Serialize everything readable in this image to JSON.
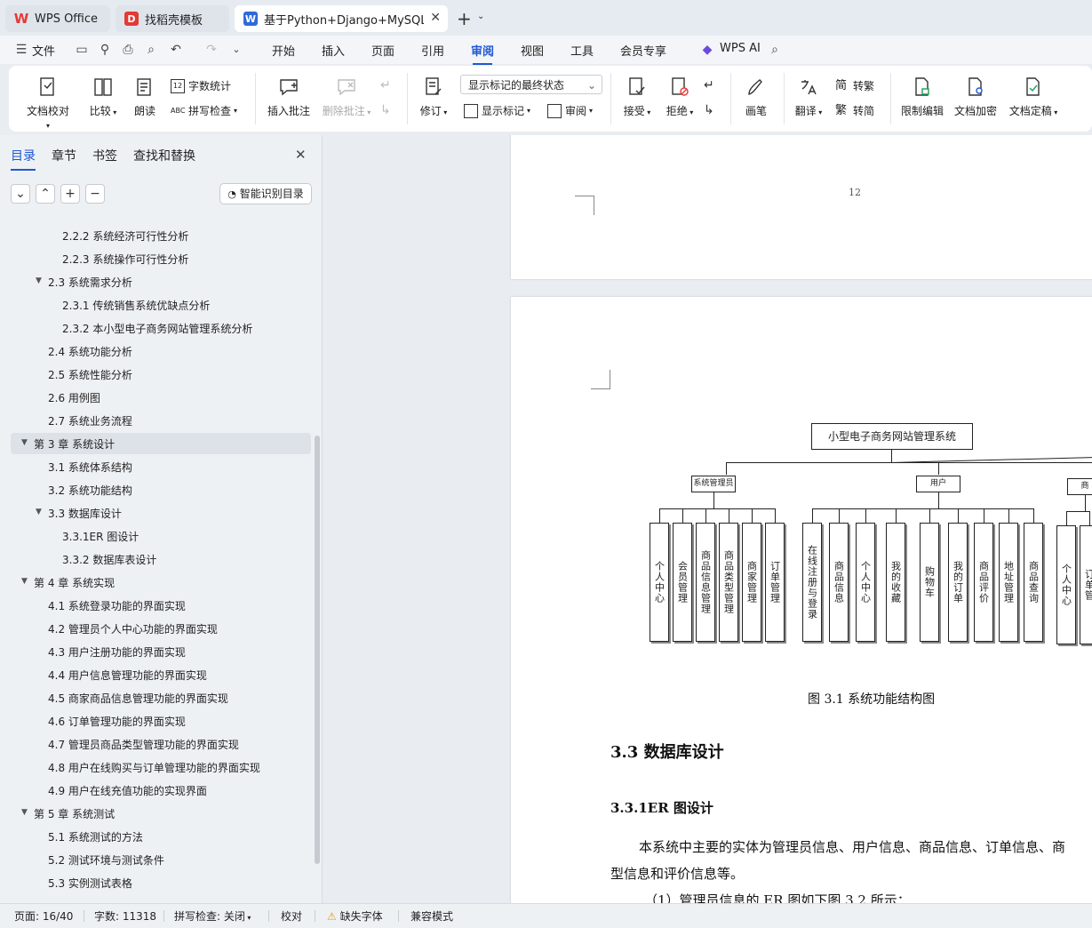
{
  "tabs": [
    {
      "label": "WPS Office",
      "icon": "wps-logo-icon"
    },
    {
      "label": "找稻壳模板",
      "icon": "docer-icon"
    },
    {
      "label": "基于Python+Django+MySQL",
      "icon": "word-doc-icon"
    }
  ],
  "menu": {
    "file_label": "文件",
    "items": [
      "开始",
      "插入",
      "页面",
      "引用",
      "审阅",
      "视图",
      "工具",
      "会员专享"
    ],
    "active": "审阅",
    "wps_ai_label": "WPS AI"
  },
  "ribbon": {
    "doc_proofread": "文档校对",
    "compare": "比较",
    "read_aloud": "朗读",
    "word_count": "字数统计",
    "spell_check": "拼写检查",
    "insert_comment": "插入批注",
    "delete_comment": "删除批注",
    "revise": "修订",
    "markup_state": "显示标记的最终状态",
    "show_markup": "显示标记",
    "review": "审阅",
    "accept": "接受",
    "reject": "拒绝",
    "pen": "画笔",
    "translate": "翻译",
    "to_traditional": "转繁",
    "to_simplified": "转简",
    "trad_glyph": "繁",
    "simp_glyph": "简",
    "restrict_edit": "限制编辑",
    "encrypt": "文档加密",
    "finalize": "文档定稿"
  },
  "nav": {
    "tabs": [
      "目录",
      "章节",
      "书签",
      "查找和替换"
    ],
    "smart_toc_label": "智能识别目录",
    "items": [
      {
        "text": "2.2.2 系统经济可行性分析",
        "level": 3
      },
      {
        "text": "2.2.3 系统操作可行性分析",
        "level": 3
      },
      {
        "text": "2.3 系统需求分析",
        "level": 2,
        "expanded": true
      },
      {
        "text": "2.3.1 传统销售系统优缺点分析",
        "level": 3
      },
      {
        "text": "2.3.2 本小型电子商务网站管理系统分析",
        "level": 3
      },
      {
        "text": "2.4 系统功能分析",
        "level": 2
      },
      {
        "text": "2.5 系统性能分析",
        "level": 2
      },
      {
        "text": "2.6 用例图",
        "level": 2
      },
      {
        "text": "2.7 系统业务流程",
        "level": 2
      },
      {
        "text": "第 3 章   系统设计",
        "level": 1,
        "expanded": true,
        "selected": true
      },
      {
        "text": "3.1 系统体系结构",
        "level": 2
      },
      {
        "text": "3.2 系统功能结构",
        "level": 2
      },
      {
        "text": "3.3 数据库设计",
        "level": 2,
        "expanded": true
      },
      {
        "text": "3.3.1ER 图设计",
        "level": 3
      },
      {
        "text": "3.3.2 数据库表设计",
        "level": 3
      },
      {
        "text": "第 4 章  系统实现",
        "level": 1,
        "expanded": true
      },
      {
        "text": "4.1 系统登录功能的界面实现",
        "level": 2
      },
      {
        "text": "4.2 管理员个人中心功能的界面实现",
        "level": 2
      },
      {
        "text": "4.3 用户注册功能的界面实现",
        "level": 2
      },
      {
        "text": "4.4 用户信息管理功能的界面实现",
        "level": 2
      },
      {
        "text": "4.5 商家商品信息管理功能的界面实现",
        "level": 2
      },
      {
        "text": "4.6 订单管理功能的界面实现",
        "level": 2
      },
      {
        "text": "4.7 管理员商品类型管理功能的界面实现",
        "level": 2
      },
      {
        "text": "4.8 用户在线购买与订单管理功能的界面实现",
        "level": 2
      },
      {
        "text": "4.9 用户在线充值功能的实现界面",
        "level": 2
      },
      {
        "text": "第 5 章  系统测试",
        "level": 1,
        "expanded": true
      },
      {
        "text": "5.1 系统测试的方法",
        "level": 2
      },
      {
        "text": "5.2 测试环境与测试条件",
        "level": 2
      },
      {
        "text": "5.3 实例测试表格",
        "level": 2
      }
    ]
  },
  "document": {
    "page_number": "12",
    "diagram": {
      "root": "小型电子商务网站管理系统",
      "groups": [
        {
          "name": "系统管理员",
          "children": [
            "个人中心",
            "会员管理",
            "商品信息管理",
            "商品类型管理",
            "商家管理",
            "订单管理"
          ]
        },
        {
          "name": "用户",
          "children": [
            "在线注册与登录",
            "商品信息",
            "个人中心",
            "我的收藏",
            "购物车",
            "我的订单",
            "商品评价",
            "地址管理",
            "商品查询"
          ]
        },
        {
          "name": "商",
          "children": [
            "个人中心",
            "订单管"
          ]
        }
      ]
    },
    "figure_caption": "图 3.1 系统功能结构图",
    "heading_3_3": "3.3  数据库设计",
    "heading_3_3_1": "3.3.1ER 图设计",
    "para1_line1": "本系统中主要的实体为管理员信息、用户信息、商品信息、订单信息、商",
    "para1_line2": "型信息和评价信息等。",
    "para2": "（1）管理员信息的 ER 图如下图 3.2 所示："
  },
  "status": {
    "page": "页面: 16/40",
    "words": "字数: 11318",
    "spell": "拼写检查: 关闭",
    "proofread": "校对",
    "missing_font": "缺失字体",
    "compat": "兼容模式"
  }
}
